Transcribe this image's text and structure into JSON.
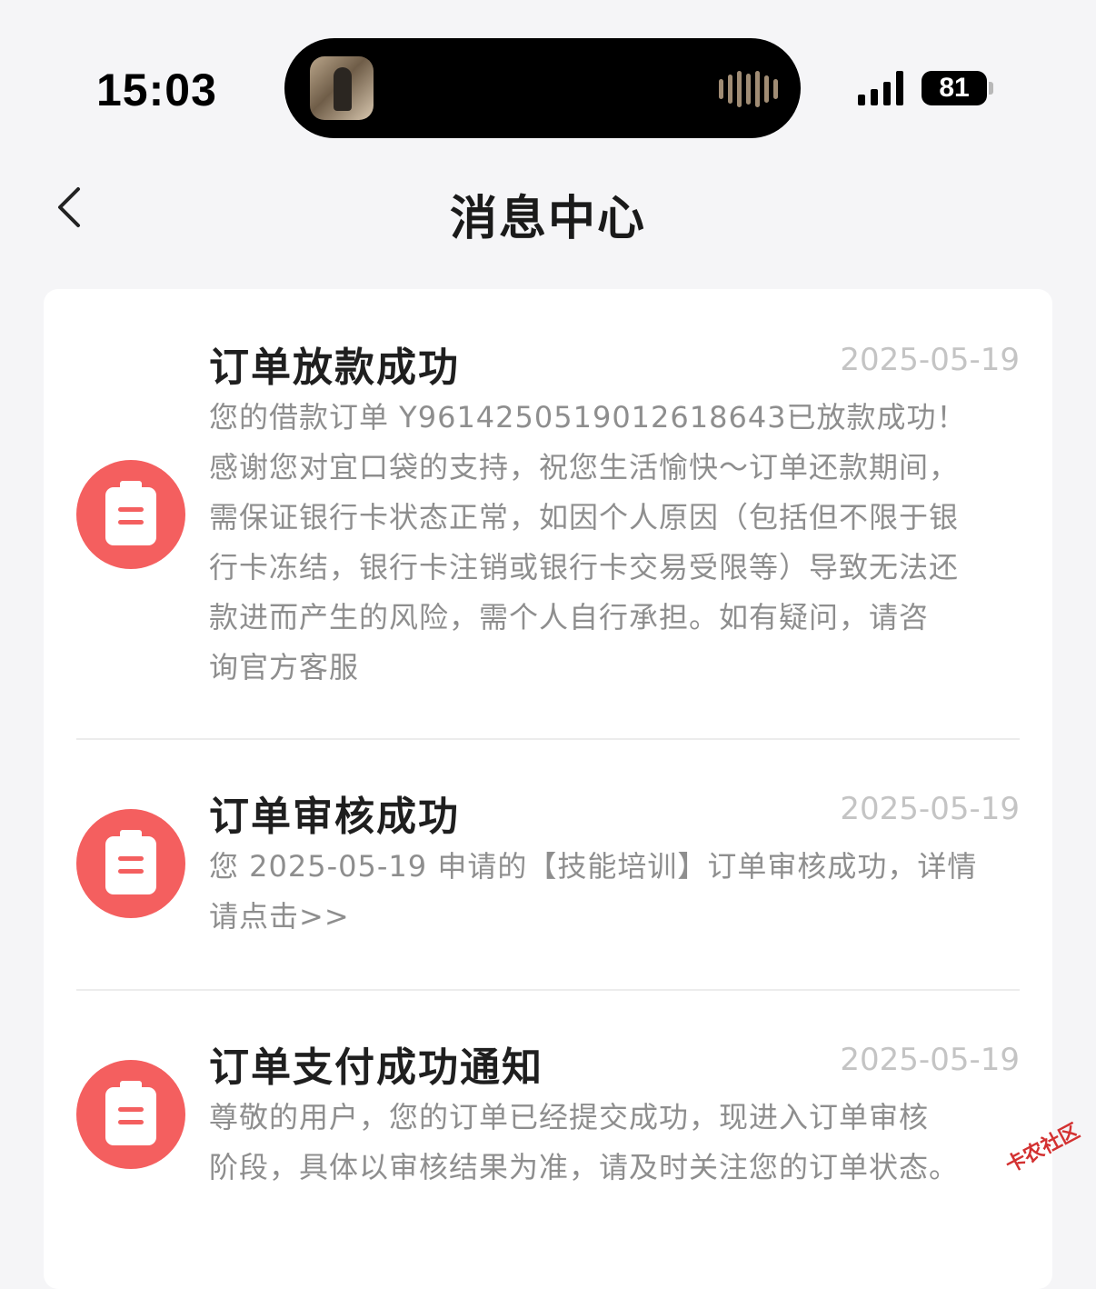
{
  "status_bar": {
    "time": "15:03",
    "battery_level": "81",
    "signal_bars": 4,
    "icons": [
      "now-playing-thumbnail",
      "audio-waveform-icon",
      "cellular-signal-icon",
      "battery-icon"
    ]
  },
  "header": {
    "title": "消息中心",
    "back_icon": "chevron-left-icon"
  },
  "messages": [
    {
      "icon": "clipboard-icon",
      "title": "订单放款成功",
      "date": "2025-05-19",
      "body": "您的借款订单 Y961425051901261864 3已放款成功！感谢您对宜口袋的支持，祝您生活愉快～订单还款期间，需保证银行卡状态正常，如因个人原因（包括但不限于银行卡冻结，银行卡注销或银行卡交易受限等）导致无法还款进而产生的风险，需个人自行承担。如有疑问，请咨询官方客服",
      "body_lines": [
        "您的借款订单 Y9614250519012618643已放款成功！",
        "感谢您对宜口袋的支持，祝您生活愉快～订单还款期间，",
        "需保证银行卡状态正常，如因个人原因（包括但不限于银",
        "行卡冻结，银行卡注销或银行卡交易受限等）导致无法还",
        "款进而产生的风险，需个人自行承担。如有疑问，请咨",
        "询官方客服"
      ]
    },
    {
      "icon": "clipboard-icon",
      "title": "订单审核成功",
      "date": "2025-05-19",
      "body_lines": [
        "您 2025-05-19 申请的【技能培训】订单审核成功，详情",
        "请点击>>"
      ]
    },
    {
      "icon": "clipboard-icon",
      "title": "订单支付成功通知",
      "date": "2025-05-19",
      "body_lines": [
        "尊敬的用户，您的订单已经提交成功，现进入订单审核",
        "阶段，具体以审核结果为准，请及时关注您的订单状态。"
      ]
    }
  ],
  "watermark": {
    "text": "卡农社区"
  },
  "colors": {
    "accent": "#f45f5f",
    "background": "#f5f5f7",
    "title_text": "#1f1f1f",
    "body_text": "#8e8e8e",
    "date_text": "#c4c4c4"
  }
}
